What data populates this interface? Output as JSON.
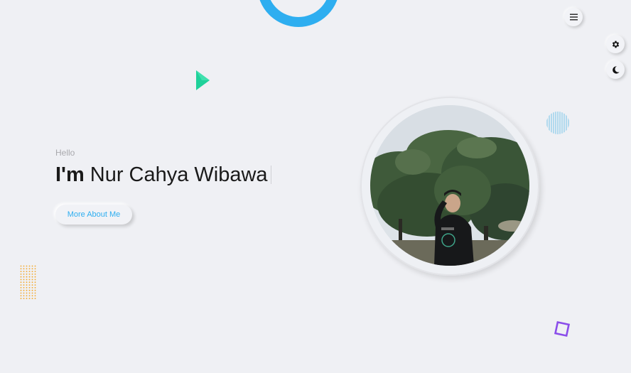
{
  "header": {
    "menu_icon": "hamburger-menu-icon"
  },
  "side_controls": {
    "settings_icon": "gear-icon",
    "theme_icon": "moon-icon"
  },
  "hero": {
    "greeting": "Hello",
    "headline_prefix": "I'm",
    "name": "Nur Cahya Wibawa",
    "cta_label": "More About Me"
  },
  "colors": {
    "background": "#eff0f4",
    "accent_blue": "#2eaef0",
    "triangle_green": "#1fd19a",
    "dots_orange": "#f5a623",
    "square_purple": "#8a4dea"
  }
}
